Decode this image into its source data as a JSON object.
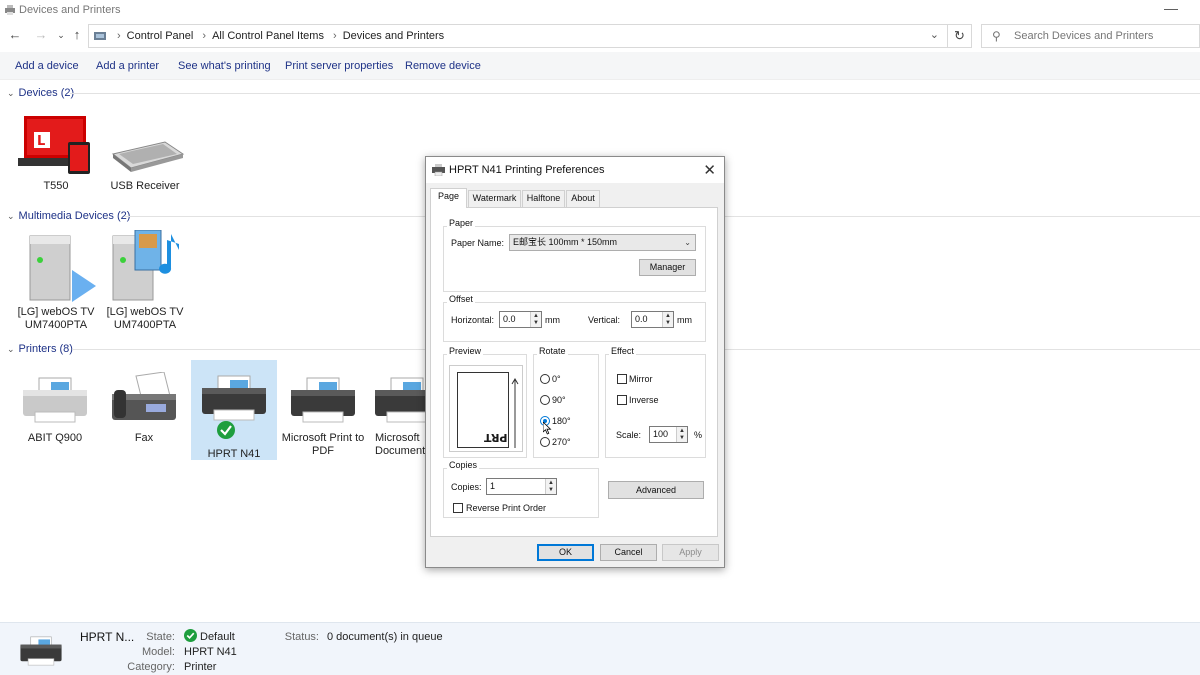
{
  "window": {
    "title": "Devices and Printers"
  },
  "nav": {
    "crumbs": [
      "Control Panel",
      "All Control Panel Items",
      "Devices and Printers"
    ],
    "search_placeholder": "Search Devices and Printers"
  },
  "commands": [
    "Add a device",
    "Add a printer",
    "See what's printing",
    "Print server properties",
    "Remove device"
  ],
  "groups": {
    "devices": {
      "header": "Devices (2)",
      "items": [
        "T550",
        "USB Receiver"
      ]
    },
    "multimedia": {
      "header": "Multimedia Devices (2)",
      "items": [
        [
          "[LG] webOS TV",
          "UM7400PTA"
        ],
        [
          "[LG] webOS TV",
          "UM7400PTA"
        ]
      ]
    },
    "printers": {
      "header": "Printers (8)",
      "items": [
        [
          "ABIT Q900",
          ""
        ],
        [
          "Fax",
          ""
        ],
        [
          "HPRT N41",
          ""
        ],
        [
          "Microsoft Print to",
          "PDF"
        ],
        [
          "Microsoft",
          "Document W"
        ]
      ]
    }
  },
  "details": {
    "name": "HPRT N...",
    "state_label": "State:",
    "state_value": "Default",
    "model_label": "Model:",
    "model_value": "HPRT N41",
    "category_label": "Category:",
    "category_value": "Printer",
    "status_label": "Status:",
    "status_value": "0 document(s) in queue"
  },
  "dialog": {
    "title": "HPRT N41 Printing Preferences",
    "tabs": [
      "Page",
      "Watermark",
      "Halftone",
      "About"
    ],
    "paper": {
      "group": "Paper",
      "name_label": "Paper Name:",
      "name_value": "E邮宝长 100mm * 150mm",
      "manager_button": "Manager"
    },
    "offset": {
      "group": "Offset",
      "horizontal_label": "Horizontal:",
      "horizontal_value": "0.0",
      "vertical_label": "Vertical:",
      "vertical_value": "0.0",
      "unit": "mm"
    },
    "preview": {
      "group": "Preview",
      "sample_text": "PRT"
    },
    "rotate": {
      "group": "Rotate",
      "options": [
        "0°",
        "90°",
        "180°",
        "270°"
      ],
      "selected": "180°"
    },
    "effect": {
      "group": "Effect",
      "mirror_label": "Mirror",
      "inverse_label": "Inverse",
      "scale_label": "Scale:",
      "scale_value": "100",
      "scale_unit": "%"
    },
    "copies": {
      "group": "Copies",
      "copies_label": "Copies:",
      "copies_value": "1",
      "reverse_label": "Reverse Print Order"
    },
    "advanced_button": "Advanced",
    "ok_button": "OK",
    "cancel_button": "Cancel",
    "apply_button": "Apply"
  },
  "colors": {
    "link": "#1e3287",
    "selection": "#cce4f7",
    "accent": "#0078d7",
    "ok_green": "#1e9e3e"
  }
}
